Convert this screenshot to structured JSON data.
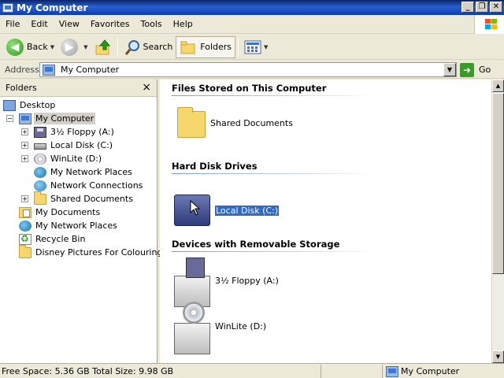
{
  "window": {
    "title": "My Computer",
    "controls": {
      "minimize": "_",
      "restore": "❐",
      "close": "✕"
    }
  },
  "menu": [
    "File",
    "Edit",
    "View",
    "Favorites",
    "Tools",
    "Help"
  ],
  "toolbar": {
    "back_label": "Back",
    "search_label": "Search",
    "folders_label": "Folders"
  },
  "address": {
    "label": "Address",
    "value": "My Computer",
    "go_label": "Go"
  },
  "folders_pane": {
    "title": "Folders",
    "tree": [
      {
        "label": "Desktop",
        "icon": "desktop-icon",
        "expander": ""
      },
      {
        "label": "My Computer",
        "icon": "computer-icon",
        "expander": "−",
        "selected": true
      },
      {
        "label": "3½ Floppy (A:)",
        "icon": "floppy-icon",
        "expander": "+"
      },
      {
        "label": "Local Disk (C:)",
        "icon": "disk-icon",
        "expander": "+"
      },
      {
        "label": "WinLite (D:)",
        "icon": "cd-icon",
        "expander": "+"
      },
      {
        "label": "My Network Places",
        "icon": "network-icon",
        "expander": ""
      },
      {
        "label": "Network Connections",
        "icon": "connections-icon",
        "expander": ""
      },
      {
        "label": "Shared Documents",
        "icon": "folder-icon",
        "expander": "+"
      },
      {
        "label": "My Documents",
        "icon": "documents-icon",
        "expander": ""
      },
      {
        "label": "My Network Places",
        "icon": "network-icon",
        "expander": ""
      },
      {
        "label": "Recycle Bin",
        "icon": "recycle-bin-icon",
        "expander": ""
      },
      {
        "label": "Disney Pictures For Colouring",
        "icon": "folder-icon",
        "expander": ""
      }
    ]
  },
  "content": {
    "groups": [
      {
        "title": "Files Stored on This Computer",
        "items": [
          {
            "name": "Shared Documents",
            "icon": "folder-icon"
          }
        ]
      },
      {
        "title": "Hard Disk Drives",
        "items": [
          {
            "name": "Local Disk (C:)",
            "icon": "hard-disk-icon",
            "selected": true
          }
        ]
      },
      {
        "title": "Devices with Removable Storage",
        "items": [
          {
            "name": "3½ Floppy (A:)",
            "icon": "floppy-drive-icon"
          },
          {
            "name": "WinLite (D:)",
            "icon": "cd-drive-icon"
          }
        ]
      }
    ]
  },
  "status": {
    "space": "Free Space: 5.36 GB Total Size: 9.98 GB",
    "location": "My Computer"
  }
}
